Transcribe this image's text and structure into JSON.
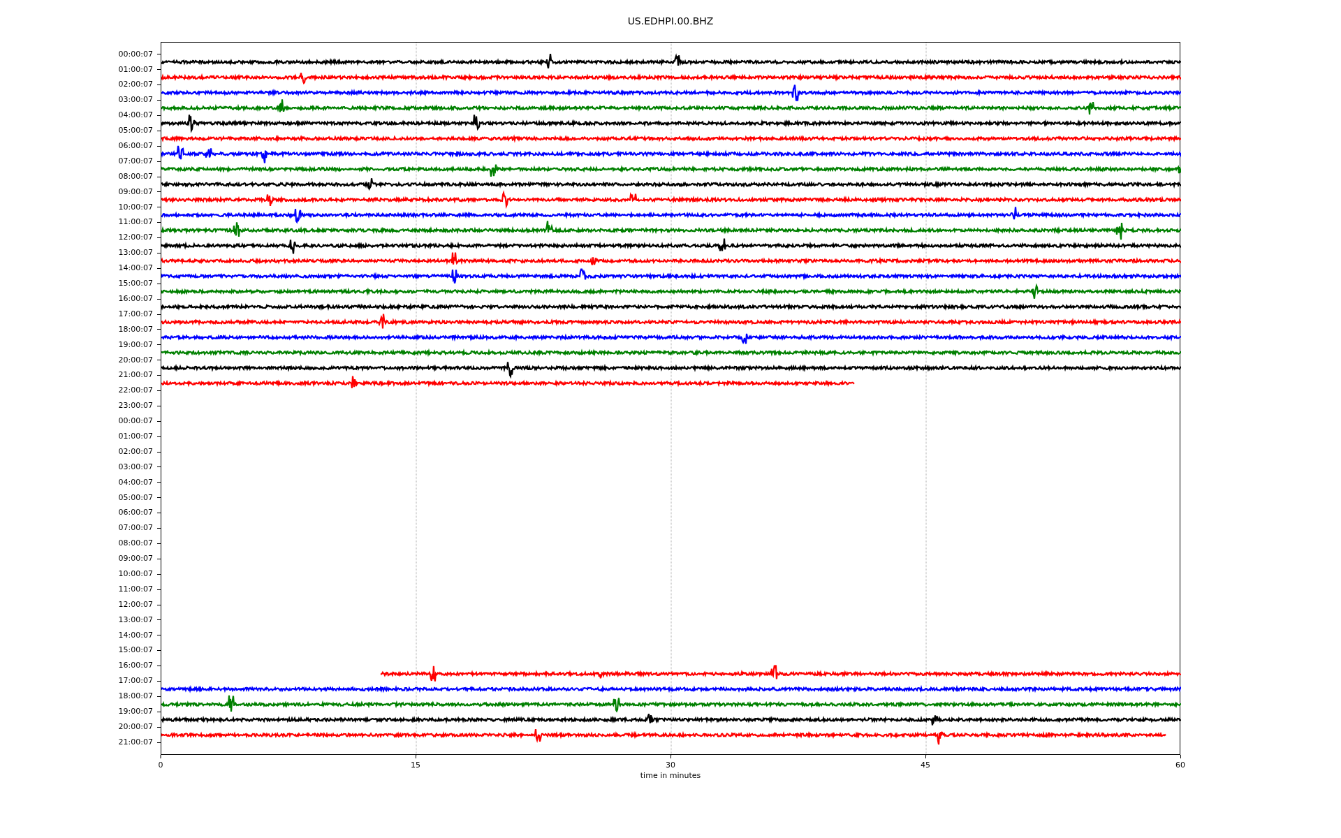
{
  "title": "US.EDHPI.00.BHZ",
  "rows": [
    {
      "label": "00:00:07",
      "trace": {
        "color": "#000000",
        "kind": "from_left",
        "level": 1
      }
    },
    {
      "label": "01:00:07",
      "trace": {
        "color": "#ff0000",
        "kind": "from_left",
        "level": 1
      }
    },
    {
      "label": "02:00:07",
      "trace": {
        "color": "#0000ff",
        "kind": "from_left",
        "level": 1
      }
    },
    {
      "label": "03:00:07",
      "trace": {
        "color": "#008000",
        "kind": "from_left",
        "level": 1
      }
    },
    {
      "label": "04:00:07",
      "trace": {
        "color": "#000000",
        "kind": "from_left",
        "level": 1
      }
    },
    {
      "label": "05:00:07",
      "trace": {
        "color": "#ff0000",
        "kind": "from_left",
        "level": 1
      }
    },
    {
      "label": "06:00:07",
      "trace": {
        "color": "#0000ff",
        "kind": "from_left",
        "level": 1
      }
    },
    {
      "label": "07:00:07",
      "trace": {
        "color": "#008000",
        "kind": "from_left",
        "level": 1
      }
    },
    {
      "label": "08:00:07",
      "trace": {
        "color": "#000000",
        "kind": "from_left",
        "level": 1
      }
    },
    {
      "label": "09:00:07",
      "trace": {
        "color": "#ff0000",
        "kind": "from_left",
        "level": 1
      }
    },
    {
      "label": "10:00:07",
      "trace": {
        "color": "#0000ff",
        "kind": "from_left",
        "level": 1
      }
    },
    {
      "label": "11:00:07",
      "trace": {
        "color": "#008000",
        "kind": "from_left",
        "level": 1
      }
    },
    {
      "label": "12:00:07",
      "trace": {
        "color": "#000000",
        "kind": "from_left",
        "level": 1
      }
    },
    {
      "label": "13:00:07",
      "trace": {
        "color": "#ff0000",
        "kind": "from_left",
        "level": 1
      }
    },
    {
      "label": "14:00:07",
      "trace": {
        "color": "#0000ff",
        "kind": "from_left",
        "level": 1
      }
    },
    {
      "label": "15:00:07",
      "trace": {
        "color": "#008000",
        "kind": "from_left",
        "level": 1
      }
    },
    {
      "label": "16:00:07",
      "trace": {
        "color": "#000000",
        "kind": "from_left",
        "level": 1
      }
    },
    {
      "label": "17:00:07",
      "trace": {
        "color": "#ff0000",
        "kind": "from_left",
        "level": 1
      }
    },
    {
      "label": "18:00:07",
      "trace": {
        "color": "#0000ff",
        "kind": "from_left",
        "level": 1
      }
    },
    {
      "label": "19:00:07",
      "trace": {
        "color": "#008000",
        "kind": "from_left",
        "level": 1
      }
    },
    {
      "label": "20:00:07",
      "trace": {
        "color": "#000000",
        "kind": "from_left",
        "level": 1
      }
    },
    {
      "label": "21:00:07",
      "trace": {
        "color": "#ff0000",
        "kind": "from_left",
        "level": 0.68
      }
    },
    {
      "label": "22:00:07"
    },
    {
      "label": "23:00:07"
    },
    {
      "label": "00:00:07"
    },
    {
      "label": "01:00:07"
    },
    {
      "label": "02:00:07"
    },
    {
      "label": "03:00:07"
    },
    {
      "label": "04:00:07"
    },
    {
      "label": "05:00:07"
    },
    {
      "label": "06:00:07"
    },
    {
      "label": "07:00:07"
    },
    {
      "label": "08:00:07"
    },
    {
      "label": "09:00:07"
    },
    {
      "label": "10:00:07"
    },
    {
      "label": "11:00:07"
    },
    {
      "label": "12:00:07"
    },
    {
      "label": "13:00:07"
    },
    {
      "label": "14:00:07"
    },
    {
      "label": "15:00:07"
    },
    {
      "label": "16:00:07",
      "trace": {
        "color": "#ff0000",
        "kind": "to_right",
        "level": 0.785
      }
    },
    {
      "label": "17:00:07",
      "trace": {
        "color": "#0000ff",
        "kind": "from_left",
        "level": 1
      }
    },
    {
      "label": "18:00:07",
      "trace": {
        "color": "#008000",
        "kind": "from_left",
        "level": 1
      }
    },
    {
      "label": "19:00:07",
      "trace": {
        "color": "#000000",
        "kind": "from_left",
        "level": 1
      }
    },
    {
      "label": "20:00:07",
      "trace": {
        "color": "#ff0000",
        "kind": "from_left",
        "level": 0.985
      }
    },
    {
      "label": "21:00:07"
    }
  ],
  "xticks": [
    "0",
    "15",
    "30",
    "45",
    "60"
  ],
  "xlabel": "time in minutes"
}
